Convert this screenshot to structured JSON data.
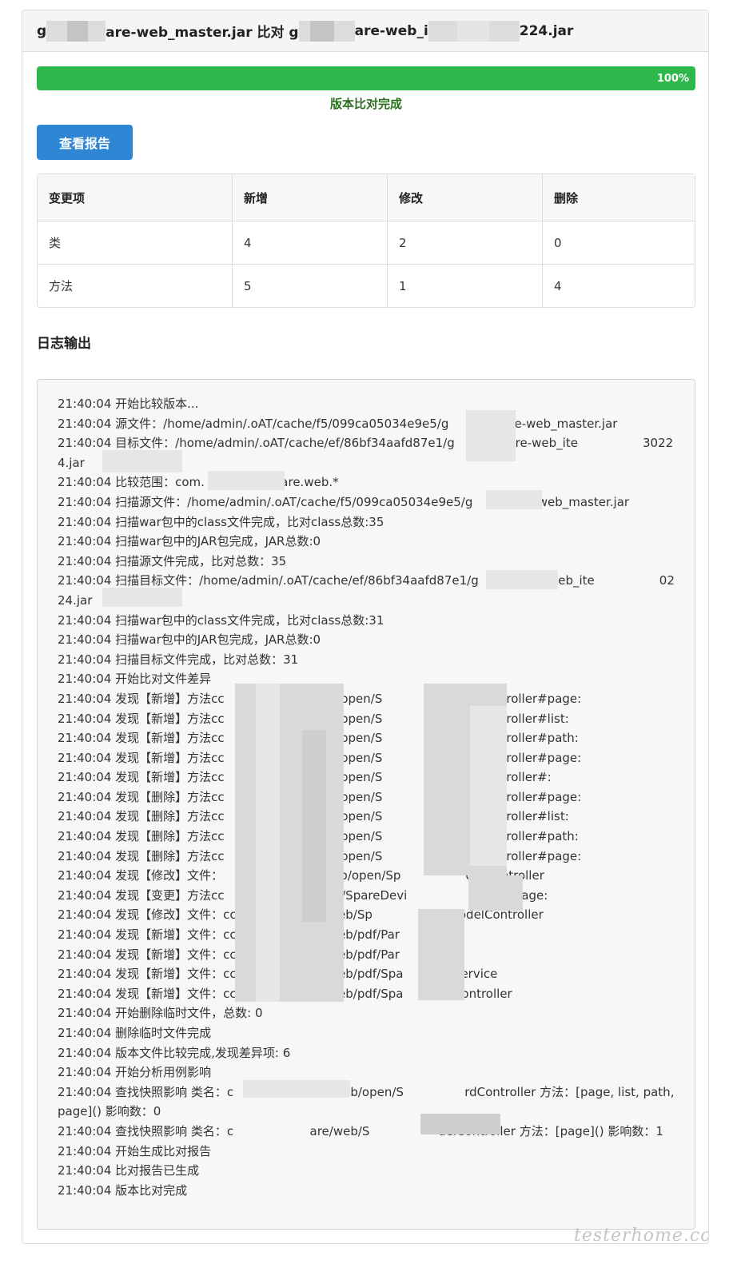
{
  "header": {
    "title_part1": "g",
    "title_part2": "are-web_master.jar 比对 g",
    "title_part3": "are-web_i",
    "title_part4": "224.jar"
  },
  "progress": {
    "value": 100,
    "label": "100%",
    "status": "版本比对完成",
    "bar_color": "#2eb84b"
  },
  "report_button": {
    "label": "查看报告",
    "color": "#2e86d4"
  },
  "diff_table": {
    "headers": [
      "变更项",
      "新增",
      "修改",
      "删除"
    ],
    "rows": [
      [
        "类",
        "4",
        "2",
        "0"
      ],
      [
        "方法",
        "5",
        "1",
        "4"
      ]
    ]
  },
  "log": {
    "title": "日志输出",
    "lines": [
      "21:40:04 开始比较版本...",
      "21:40:04 源文件：/home/admin/.oAT/cache/f5/099ca05034e9e5/g                re-web_master.jar",
      "21:40:04 目标文件：/home/admin/.oAT/cache/ef/86bf34aafd87e1/g              are-web_ite                 30224.jar",
      "21:40:04 比较范围：com.                    are.web.*",
      "21:40:04 扫描源文件：/home/admin/.oAT/cache/f5/099ca05034e9e5/g              e-web_master.jar",
      "21:40:04 扫描war包中的class文件完成，比对class总数:35",
      "21:40:04 扫描war包中的JAR包完成，JAR总数:0",
      "21:40:04 扫描源文件完成，比对总数：35",
      "21:40:04 扫描目标文件：/home/admin/.oAT/cache/ef/86bf34aafd87e1/g              re-web_ite                 0224.jar",
      "21:40:04 扫描war包中的class文件完成，比对class总数:31",
      "21:40:04 扫描war包中的JAR包完成，JAR总数:0",
      "21:40:04 扫描目标文件完成，比对总数：31",
      "21:40:04 开始比对文件差异",
      "21:40:04 发现【新增】方法cc                    e/web/open/S                    ordController#page:",
      "21:40:04 发现【新增】方法cc                    e/web/open/S                    ordController#list:",
      "21:40:04 发现【新增】方法cc                    e/web/open/S                    ordController#path:",
      "21:40:04 发现【新增】方法cc                    e/web/open/S                    ordController#page:",
      "21:40:04 发现【新增】方法cc                    e/web/open/S                    ordController#:",
      "21:40:04 发现【删除】方法cc                    e/web/open/S                    ordController#page:",
      "21:40:04 发现【删除】方法cc                    e/web/open/S                    ordController#list:",
      "21:40:04 发现【删除】方法cc                    e/web/open/S                    ordController#path:",
      "21:40:04 发现【删除】方法cc                    e/web/open/S                    ordController#page:",
      "21:40:04 发现【修改】文件：                    are/web/open/Sp                 ordController",
      "21:40:04 发现【变更】方法cc                    re/web/SpareDevi                troller#page:",
      "21:40:04 发现【修改】文件：cc                  are/web/Sp                  eModelController",
      "21:40:04 发现【新增】文件：cc                  are/web/pdf/Par          ow",
      "21:40:04 发现【新增】文件：cc                  are/web/pdf/Par          fo",
      "21:40:04 发现【新增】文件：cc                  are/web/pdf/Spa          dfService",
      "21:40:04 发现【新增】文件：cc                  are/web/pdf/Spa          dfController",
      "21:40:04 开始删除临时文件，总数: 0",
      "21:40:04 删除临时文件完成",
      "21:40:04 版本文件比较完成,发现差异项: 6",
      "21:40:04 开始分析用例影响",
      "21:40:04 查找快照影响 类名：c                    are/web/open/S                rdController 方法：[page, list, path, page]() 影响数：0",
      "21:40:04 查找快照影响 类名：c                    are/web/S                  delController 方法：[page]() 影响数：1",
      "21:40:04 开始生成比对报告",
      "21:40:04 比对报告已生成",
      "21:40:04 版本比对完成"
    ]
  },
  "watermark": "testerhome.com"
}
